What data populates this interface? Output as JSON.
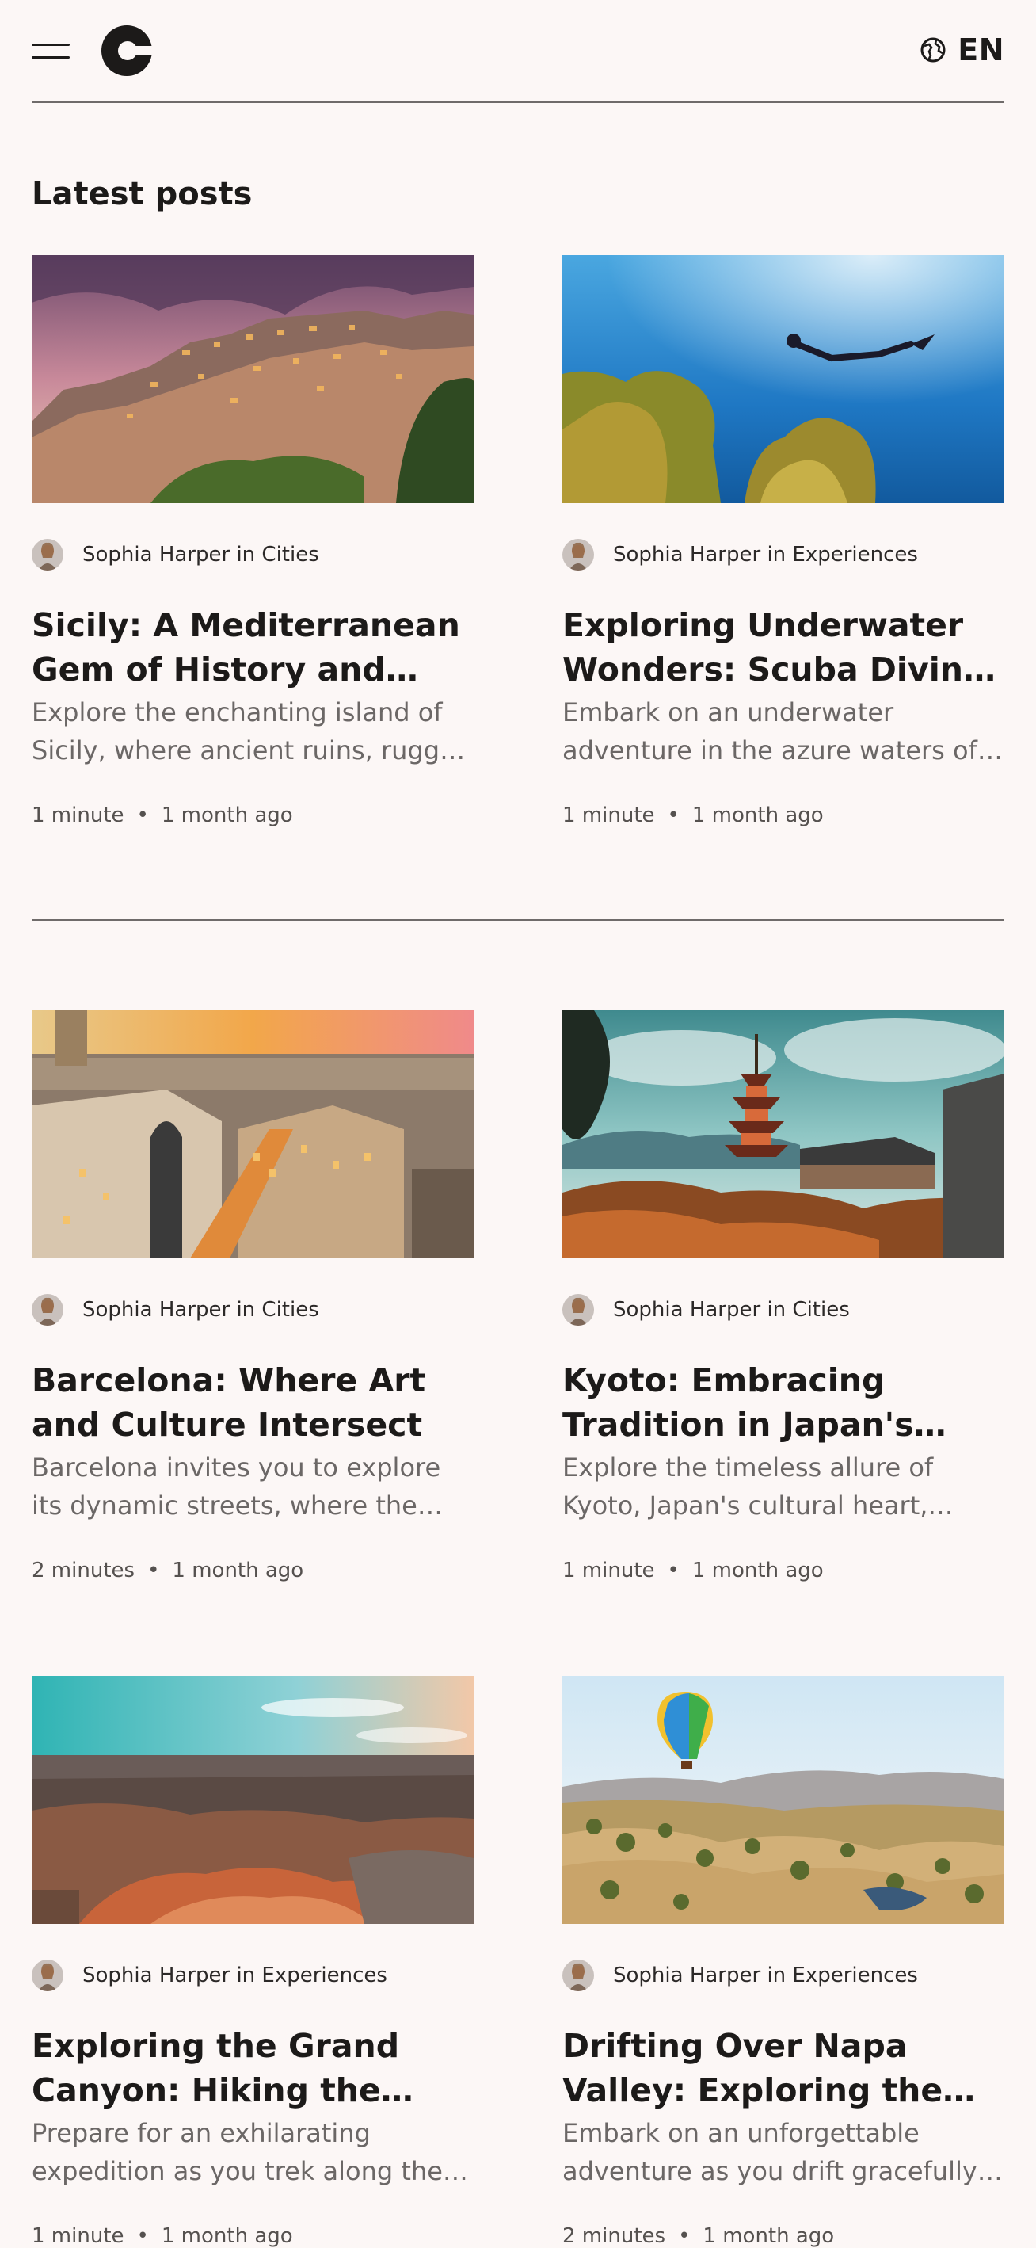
{
  "header": {
    "language_label": "EN"
  },
  "section": {
    "title": "Latest posts"
  },
  "posts": [
    {
      "author": "Sophia Harper",
      "category_prefix": "in",
      "category": "Cities",
      "title": "Sicily: A Mediterranean Gem of History and Beauty",
      "excerpt": "Explore the enchanting island of Sicily, where ancient ruins, rugged coastlines and charming villages await",
      "read_time": "1 minute",
      "posted": "1 month ago"
    },
    {
      "author": "Sophia Harper",
      "category_prefix": "in",
      "category": "Experiences",
      "title": "Exploring Underwater Wonders: Scuba Diving in the Great Barrier Reef",
      "excerpt": "Embark on an underwater adventure in the azure waters of the reef",
      "read_time": "1 minute",
      "posted": "1 month ago"
    },
    {
      "author": "Sophia Harper",
      "category_prefix": "in",
      "category": "Cities",
      "title": "Barcelona: Where Art and Culture Intersect",
      "excerpt": "Barcelona invites you to explore its dynamic streets, where the echoes of history meet modern art",
      "read_time": "2 minutes",
      "posted": "1 month ago"
    },
    {
      "author": "Sophia Harper",
      "category_prefix": "in",
      "category": "Cities",
      "title": "Kyoto: Embracing Tradition in Japan's Cultural Heart",
      "excerpt": "Explore the timeless allure of Kyoto, Japan's cultural heart, where temples and gardens await",
      "read_time": "1 minute",
      "posted": "1 month ago"
    },
    {
      "author": "Sophia Harper",
      "category_prefix": "in",
      "category": "Experiences",
      "title": "Exploring the Grand Canyon: Hiking the South Rim",
      "excerpt": "Prepare for an exhilarating expedition as you trek along the canyon rim",
      "read_time": "1 minute",
      "posted": "1 month ago"
    },
    {
      "author": "Sophia Harper",
      "category_prefix": "in",
      "category": "Experiences",
      "title": "Drifting Over Napa Valley: Exploring the Skies on a Hot Air Balloon",
      "excerpt": "Embark on an unforgettable adventure as you drift gracefully over the vineyards",
      "read_time": "2 minutes",
      "posted": "1 month ago"
    }
  ],
  "colors": {
    "background": "#fcf7f6",
    "text": "#1c1a19",
    "muted": "#6b6766",
    "divider": "#6f6b6a"
  },
  "icons": {
    "menu": "hamburger-icon",
    "logo": "c-logo-icon",
    "language": "globe-icon"
  }
}
